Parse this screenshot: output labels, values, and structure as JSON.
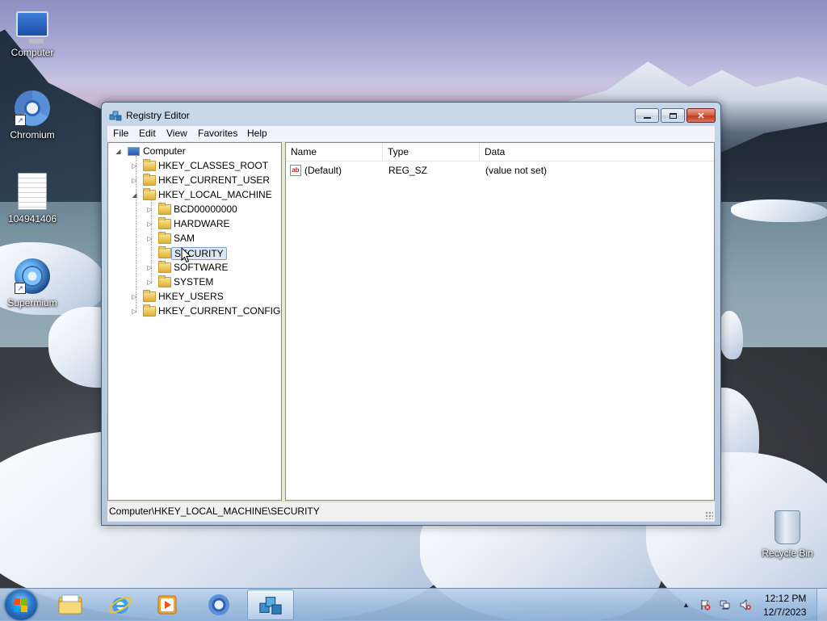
{
  "desktop": {
    "icons": [
      {
        "label": "Computer"
      },
      {
        "label": "Chromium"
      },
      {
        "label": "104941406"
      },
      {
        "label": "Supermium"
      },
      {
        "label": "Recycle Bin"
      }
    ]
  },
  "window": {
    "title": "Registry Editor",
    "menu": [
      "File",
      "Edit",
      "View",
      "Favorites",
      "Help"
    ],
    "caption_buttons": {
      "minimize": "minimize",
      "maximize": "maximize",
      "close": "✕"
    }
  },
  "tree": {
    "root": "Computer",
    "hives": [
      "HKEY_CLASSES_ROOT",
      "HKEY_CURRENT_USER",
      "HKEY_LOCAL_MACHINE",
      "HKEY_USERS",
      "HKEY_CURRENT_CONFIG"
    ],
    "hklm_children": [
      "BCD00000000",
      "HARDWARE",
      "SAM",
      "SECURITY",
      "SOFTWARE",
      "SYSTEM"
    ],
    "selected": "SECURITY"
  },
  "list": {
    "columns": [
      "Name",
      "Type",
      "Data"
    ],
    "rows": [
      {
        "name": "(Default)",
        "type": "REG_SZ",
        "data": "(value not set)",
        "icon": "ab"
      }
    ]
  },
  "statusbar": {
    "path": "Computer\\HKEY_LOCAL_MACHINE\\SECURITY"
  },
  "taskbar": {
    "pinned": [
      "file-explorer-icon",
      "internet-explorer-icon",
      "media-player-icon",
      "chromium-icon",
      "registry-editor-icon"
    ],
    "active": "registry-editor-icon",
    "tray": {
      "overflow": "▲",
      "time": "12:12 PM",
      "date": "12/7/2023"
    }
  },
  "colors": {
    "title_bar": "#c8d7e8",
    "close_button": "#c3391f",
    "selection": "#dde8f6",
    "taskbar": "#a0bee0"
  }
}
